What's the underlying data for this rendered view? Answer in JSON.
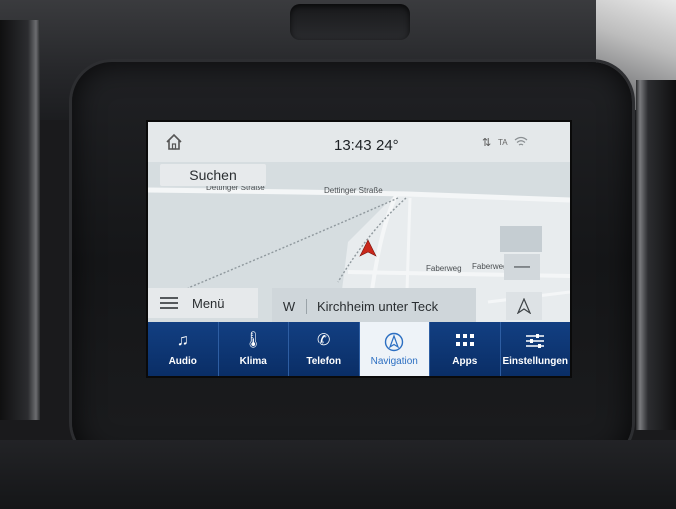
{
  "status": {
    "time": "13:43",
    "temperature": "24°",
    "ta_label": "TA"
  },
  "map": {
    "search_label": "Suchen",
    "streets": [
      "Dettinger Straße",
      "Dettinger Straße",
      "Faberweg",
      "Faberweg"
    ],
    "zoom_out_label": "—"
  },
  "menu": {
    "label": "Menü"
  },
  "destination": {
    "direction": "W",
    "name": "Kirchheim unter Teck"
  },
  "tabs": [
    {
      "id": "audio",
      "label": "Audio",
      "icon": "music-note-icon"
    },
    {
      "id": "klima",
      "label": "Klima",
      "icon": "thermometer-icon"
    },
    {
      "id": "telefon",
      "label": "Telefon",
      "icon": "phone-icon"
    },
    {
      "id": "navigation",
      "label": "Navigation",
      "icon": "navigation-icon",
      "active": true
    },
    {
      "id": "apps",
      "label": "Apps",
      "icon": "apps-grid-icon"
    },
    {
      "id": "einstellungen",
      "label": "Einstellungen",
      "icon": "settings-sliders-icon"
    }
  ],
  "colors": {
    "tabbar": "#0f3a7a",
    "active_tab": "#eef3f8",
    "accent": "#2c6fc2",
    "position_arrow": "#c9281c"
  }
}
